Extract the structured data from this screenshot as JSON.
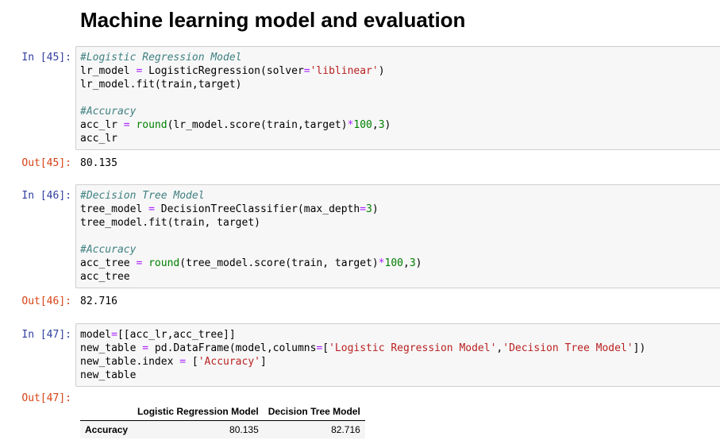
{
  "heading": "Machine learning model and evaluation",
  "cells": [
    {
      "in_prompt": "In [45]:",
      "code_lines": [
        "#Logistic Regression Model",
        "lr_model = LogisticRegression(solver='liblinear')",
        "lr_model.fit(train,target)",
        "",
        "#Accuracy",
        "acc_lr = round(lr_model.score(train,target)*100,3)",
        "acc_lr"
      ],
      "out_prompt": "Out[45]:",
      "output": "80.135"
    },
    {
      "in_prompt": "In [46]:",
      "code_lines": [
        "#Decision Tree Model",
        "tree_model = DecisionTreeClassifier(max_depth=3)",
        "tree_model.fit(train, target)",
        "",
        "#Accuracy",
        "acc_tree = round(tree_model.score(train, target)*100,3)",
        "acc_tree"
      ],
      "out_prompt": "Out[46]:",
      "output": "82.716"
    },
    {
      "in_prompt": "In [47]:",
      "code_lines": [
        "model=[[acc_lr,acc_tree]]",
        "new_table = pd.DataFrame(model,columns=['Logistic Regression Model','Decision Tree Model'])",
        "new_table.index = ['Accuracy']",
        "new_table"
      ],
      "out_prompt": "Out[47]:",
      "output_table": {
        "columns": [
          "",
          "Logistic Regression Model",
          "Decision Tree Model"
        ],
        "rows": [
          {
            "index": "Accuracy",
            "values": [
              "80.135",
              "82.716"
            ]
          }
        ]
      }
    }
  ],
  "colors": {
    "in_prompt": "#303f9f",
    "out_prompt": "#d84315",
    "comment": "#408080",
    "string": "#ba2121",
    "number": "#008000",
    "operator": "#aa22ff",
    "code_bg": "#f7f7f7"
  }
}
